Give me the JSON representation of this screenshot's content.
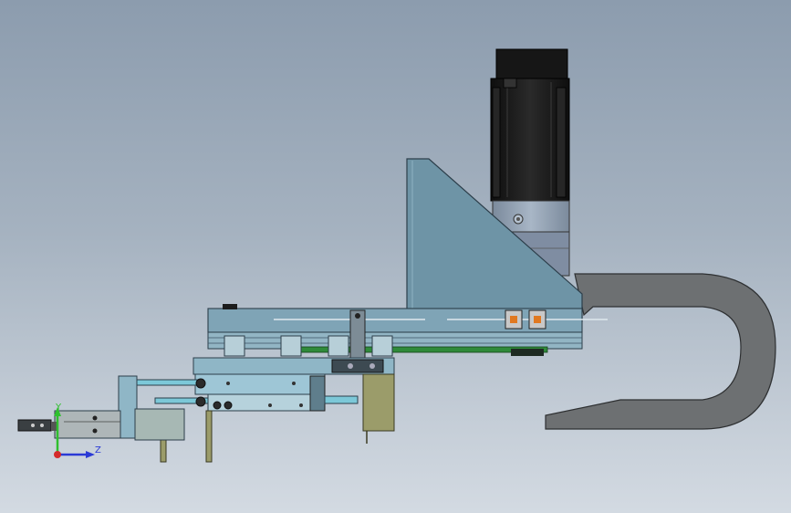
{
  "triad": {
    "y_label": "Y",
    "z_label": "Z",
    "y_color": "#2fbf2f",
    "z_color": "#2a3ad6",
    "x_color": "#d42a2a"
  },
  "colors": {
    "background_top": "#8c9cae",
    "background_bottom": "#d3dae2",
    "steel_blue": "#6e94a6",
    "light_blue": "#9ec6d6",
    "cyan": "#7cc8d8",
    "cable_gray": "#6d7072",
    "motor_black": "#1c1c1c",
    "olive": "#9b9c6a",
    "green_belt": "#2f8a3a",
    "accent_orange": "#e07820"
  }
}
